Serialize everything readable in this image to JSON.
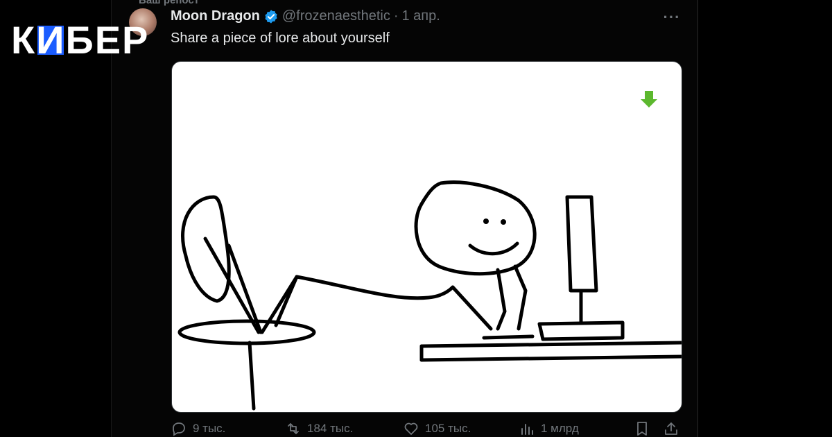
{
  "brand": {
    "text_before": "К",
    "text_mark": "И",
    "text_after": "БЕР",
    "color": "#ffffff",
    "mark_color": "#1a5cff"
  },
  "tweet": {
    "reposted_label": "Ваш репост",
    "display_name": "Moon Dragon",
    "verified_icon": "verified-badge-icon",
    "verified_color": "#1d9bf0",
    "handle": "@frozenaesthetic",
    "separator": "·",
    "date": "1 апр.",
    "more_icon": "more-dots-icon",
    "more_label": "···",
    "text": "Share a piece of lore about yourself",
    "media": {
      "image": "stick-figure-reaching-from-computer-to-chair-drawing",
      "overlay_icon": "green-down-arrow-icon",
      "overlay_color": "#5cb82e"
    },
    "actions": {
      "replies": "9 тыс.",
      "reposts": "184 тыс.",
      "likes": "105 тыс.",
      "views": "1 млрд",
      "bookmark_icon": "bookmark-icon",
      "share_icon": "share-icon"
    }
  }
}
